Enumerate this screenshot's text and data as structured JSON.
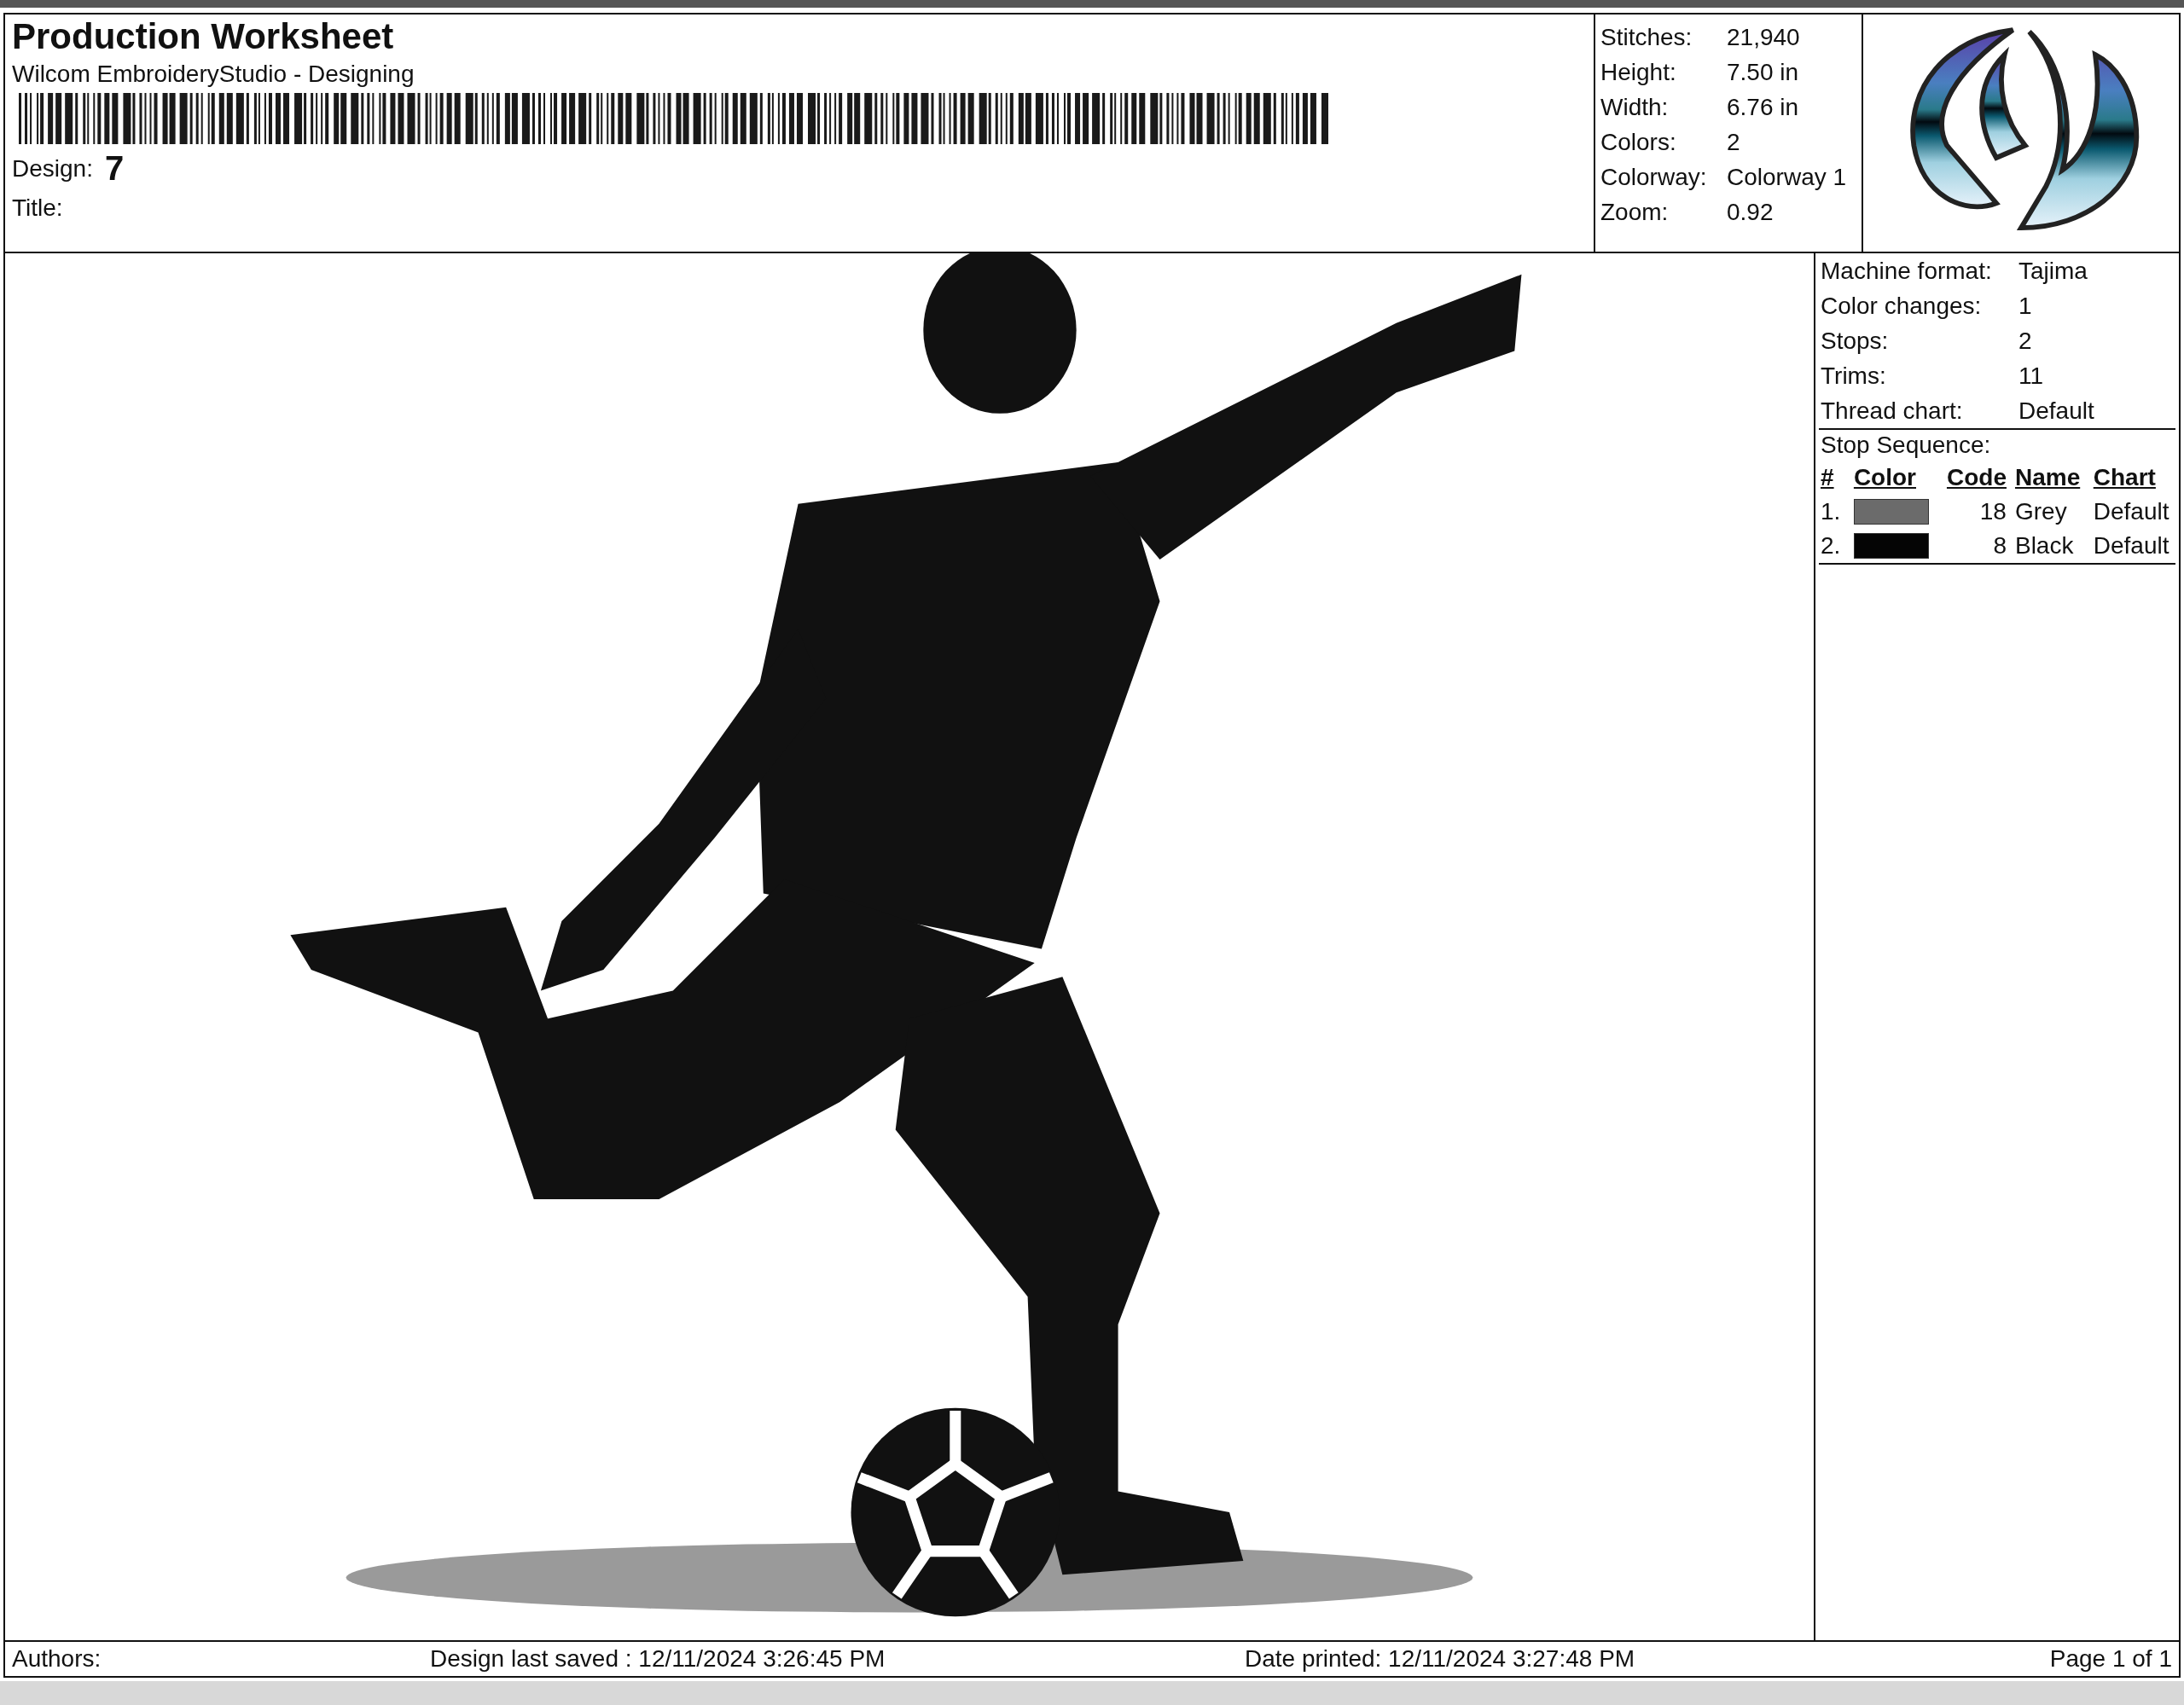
{
  "header": {
    "title": "Production Worksheet",
    "subtitle": "Wilcom EmbroideryStudio - Designing",
    "design_label": "Design:",
    "design_value": "7",
    "title_label": "Title:"
  },
  "stats": [
    {
      "label": "Stitches:",
      "value": "21,940"
    },
    {
      "label": "Height:",
      "value": "7.50 in"
    },
    {
      "label": "Width:",
      "value": "6.76 in"
    },
    {
      "label": "Colors:",
      "value": "2"
    },
    {
      "label": "Colorway:",
      "value": "Colorway 1"
    },
    {
      "label": "Zoom:",
      "value": "0.92"
    }
  ],
  "machine": [
    {
      "label": "Machine format:",
      "value": "Tajima"
    },
    {
      "label": "Color changes:",
      "value": "1"
    },
    {
      "label": "Stops:",
      "value": "2"
    },
    {
      "label": "Trims:",
      "value": "11"
    },
    {
      "label": "Thread chart:",
      "value": "Default"
    }
  ],
  "stop_sequence": {
    "title": "Stop Sequence:",
    "columns": [
      "#",
      "Color",
      "Code",
      "Name",
      "Chart"
    ],
    "rows": [
      {
        "number": "1.",
        "color": "#6b6b6b",
        "code": "18",
        "name": "Grey",
        "chart": "Default"
      },
      {
        "number": "2.",
        "color": "#050505",
        "code": "8",
        "name": "Black",
        "chart": "Default"
      }
    ]
  },
  "footer": {
    "authors": "Authors:",
    "saved": "Design last saved : 12/11/2024 3:26:45 PM",
    "printed": "Date printed: 12/11/2024 3:27:48 PM",
    "page": "Page 1 of 1"
  }
}
